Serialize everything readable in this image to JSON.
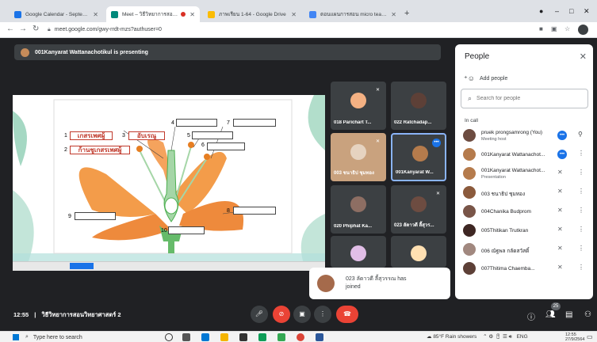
{
  "browser": {
    "tabs": [
      {
        "label": "Google Calendar - September 2(",
        "favicon_color": "#1a73e8"
      },
      {
        "label": "Meet – วิธีวิทยาการสอนวิทยาศาส",
        "favicon_color": "#00897b",
        "recording": true
      },
      {
        "label": "ภาพเรียน 1-64 - Google Drive",
        "favicon_color": "#fbbc04"
      },
      {
        "label": "ตอนแผนการสอน micro teaching",
        "favicon_color": "#4285f4"
      }
    ],
    "url": "meet.google.com/gwy-rrdt-mzs?authuser=0"
  },
  "meet": {
    "presenting_banner": "001Kanyarat Wattanachotikul is presenting",
    "slide": {
      "numbers": [
        "1",
        "2",
        "3",
        "4",
        "5",
        "6",
        "7",
        "8",
        "9",
        "10"
      ],
      "answer_1": "เกสรเพศผู้",
      "answer_2": "ก้านชูเกสรเพศผู้",
      "answer_3": "อับเรณู"
    },
    "tiles": [
      {
        "name": "018 Parichart T...",
        "muted": true,
        "color": "#f4b183"
      },
      {
        "name": "022 Ratchadap...",
        "muted": false,
        "color": "#5d4037"
      },
      {
        "name": "003 ชนาธิป ชุมทอง",
        "muted": true,
        "color": "#c9a27e"
      },
      {
        "name": "001Kanyarat W...",
        "muted": false,
        "color": "#b57b4c",
        "speaking": true
      },
      {
        "name": "020 Phiphat Ka...",
        "muted": false,
        "color": "#8d6e63"
      },
      {
        "name": "023 ลัดาวดี ลี้สุวร...",
        "muted": true,
        "color": "#6d4c41"
      },
      {
        "name": "",
        "muted": false,
        "color": "#e1bee7"
      },
      {
        "name": "",
        "muted": false,
        "color": "#ffe0b2"
      }
    ],
    "toast": {
      "line1": "023 ลัดาวดี ลี้สุวรรณ has",
      "line2": "joined"
    },
    "controls": {
      "time": "12:55",
      "separator": "|",
      "meeting_name": "วิธีวิทยาการสอนวิทยาศาสตร์ 2",
      "participant_count": "25"
    }
  },
  "people_panel": {
    "title": "People",
    "add_people": "Add people",
    "search_placeholder": "Search for people",
    "in_call": "In call",
    "participants": [
      {
        "name": "pruek prongsamrong (You)",
        "sub": "Meeting host",
        "color": "#6d4c41"
      },
      {
        "name": "001Kanyarat Wattanachot...",
        "sub": "",
        "color": "#b57b4c"
      },
      {
        "name": "001Kanyarat Wattanachot...",
        "sub": "Presentation",
        "color": "#b57b4c"
      },
      {
        "name": "003 ชนาธิป ชุมทอง",
        "sub": "",
        "color": "#8b5a3c"
      },
      {
        "name": "004Chanika Budprom",
        "sub": "",
        "color": "#795548"
      },
      {
        "name": "005Thitikan Trutkran",
        "sub": "",
        "color": "#3e2723"
      },
      {
        "name": "006 ณัฐพล กลัดสวัสดิ์",
        "sub": "",
        "color": "#a1887f"
      },
      {
        "name": "007Thitima Chaemba...",
        "sub": "",
        "color": "#5d4037"
      }
    ]
  },
  "taskbar": {
    "search_placeholder": "Type here to search",
    "weather": "85°F  Rain showers",
    "lang": "ENG",
    "time": "12:55",
    "date": "27/9/2564"
  }
}
